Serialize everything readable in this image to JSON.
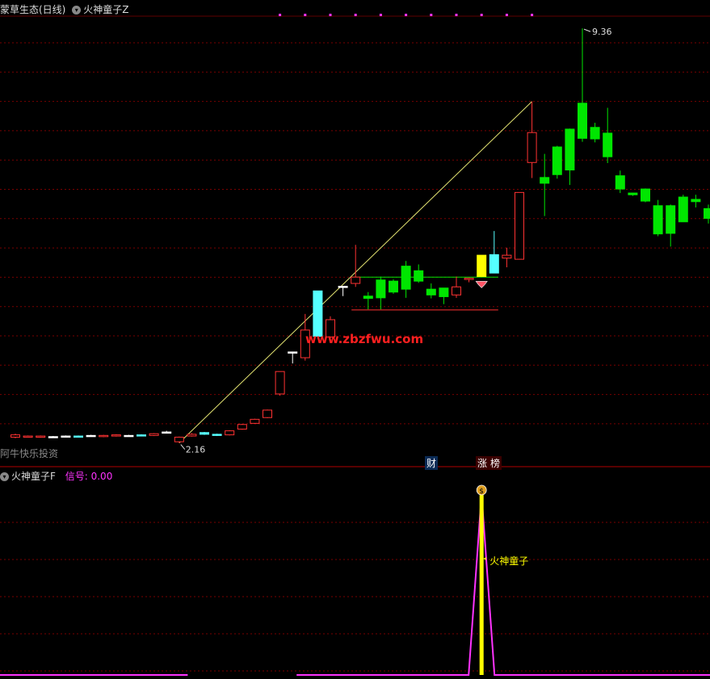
{
  "main_header": {
    "stock_name": "蒙草生态(日线)",
    "indicator_name": "火神童子Z"
  },
  "sub_header": {
    "indicator_name": "火神童子F",
    "signal_label": "信号:",
    "signal_value": "0.00"
  },
  "watermark": "www.zbzfwu.com",
  "bottom_left_label": "阿牛快乐投资",
  "markers": {
    "cai": "财",
    "zhang": "涨",
    "bang": "榜"
  },
  "colors": {
    "background": "#000000",
    "grid": "#7a0000",
    "up": "#ff3232",
    "down": "#00e600",
    "cyan": "#55ffff",
    "yellow": "#ffff00",
    "magenta": "#ff33ff",
    "trendline": "#e6e673"
  },
  "chart_data": [
    {
      "type": "candlestick",
      "title": "蒙草生态(日线)",
      "y_range": [
        2.0,
        9.6
      ],
      "low_label": "2.16",
      "high_label": "9.36",
      "candles": [
        {
          "o": 2.26,
          "c": 2.3,
          "h": 2.32,
          "l": 2.24,
          "color": "red"
        },
        {
          "o": 2.28,
          "c": 2.27,
          "h": 2.29,
          "l": 2.26,
          "color": "red"
        },
        {
          "o": 2.26,
          "c": 2.28,
          "h": 2.29,
          "l": 2.25,
          "color": "red"
        },
        {
          "o": 2.27,
          "c": 2.27,
          "h": 2.28,
          "l": 2.26,
          "color": "white"
        },
        {
          "o": 2.28,
          "c": 2.28,
          "h": 2.29,
          "l": 2.27,
          "color": "white"
        },
        {
          "o": 2.28,
          "c": 2.27,
          "h": 2.29,
          "l": 2.26,
          "color": "cyan"
        },
        {
          "o": 2.29,
          "c": 2.29,
          "h": 2.3,
          "l": 2.28,
          "color": "white"
        },
        {
          "o": 2.27,
          "c": 2.29,
          "h": 2.3,
          "l": 2.26,
          "color": "red"
        },
        {
          "o": 2.28,
          "c": 2.3,
          "h": 2.31,
          "l": 2.27,
          "color": "red"
        },
        {
          "o": 2.29,
          "c": 2.29,
          "h": 2.3,
          "l": 2.28,
          "color": "white"
        },
        {
          "o": 2.3,
          "c": 2.29,
          "h": 2.31,
          "l": 2.28,
          "color": "cyan"
        },
        {
          "o": 2.29,
          "c": 2.32,
          "h": 2.33,
          "l": 2.28,
          "color": "red"
        },
        {
          "o": 2.35,
          "c": 2.35,
          "h": 2.37,
          "l": 2.33,
          "color": "white"
        },
        {
          "o": 2.18,
          "c": 2.26,
          "h": 2.27,
          "l": 2.16,
          "color": "red"
        },
        {
          "o": 2.28,
          "c": 2.31,
          "h": 2.33,
          "l": 2.27,
          "color": "red"
        },
        {
          "o": 2.34,
          "c": 2.31,
          "h": 2.35,
          "l": 2.3,
          "color": "cyan"
        },
        {
          "o": 2.31,
          "c": 2.29,
          "h": 2.32,
          "l": 2.28,
          "color": "cyan"
        },
        {
          "o": 2.3,
          "c": 2.37,
          "h": 2.38,
          "l": 2.29,
          "color": "red"
        },
        {
          "o": 2.4,
          "c": 2.48,
          "h": 2.49,
          "l": 2.39,
          "color": "red"
        },
        {
          "o": 2.5,
          "c": 2.57,
          "h": 2.58,
          "l": 2.49,
          "color": "red"
        },
        {
          "o": 2.6,
          "c": 2.73,
          "h": 2.74,
          "l": 2.59,
          "color": "red"
        },
        {
          "o": 3.01,
          "c": 3.4,
          "h": 3.4,
          "l": 2.98,
          "color": "red"
        },
        {
          "o": 3.74,
          "c": 3.74,
          "h": 3.74,
          "l": 3.54,
          "color": "white"
        },
        {
          "o": 3.64,
          "c": 4.12,
          "h": 4.4,
          "l": 3.59,
          "color": "red"
        },
        {
          "o": 4.8,
          "c": 4.01,
          "h": 4.8,
          "l": 3.97,
          "color": "cyan"
        },
        {
          "o": 4.0,
          "c": 4.3,
          "h": 4.36,
          "l": 3.94,
          "color": "red"
        },
        {
          "o": 4.88,
          "c": 4.88,
          "h": 4.88,
          "l": 4.71,
          "color": "white"
        },
        {
          "o": 4.93,
          "c": 5.04,
          "h": 5.6,
          "l": 4.87,
          "color": "red"
        },
        {
          "o": 4.71,
          "c": 4.67,
          "h": 4.78,
          "l": 4.48,
          "color": "green"
        },
        {
          "o": 4.99,
          "c": 4.68,
          "h": 5.05,
          "l": 4.48,
          "color": "green"
        },
        {
          "o": 4.97,
          "c": 4.78,
          "h": 5.0,
          "l": 4.75,
          "color": "green"
        },
        {
          "o": 5.23,
          "c": 4.83,
          "h": 5.32,
          "l": 4.68,
          "color": "green"
        },
        {
          "o": 5.15,
          "c": 4.97,
          "h": 5.26,
          "l": 4.94,
          "color": "green"
        },
        {
          "o": 4.83,
          "c": 4.73,
          "h": 4.93,
          "l": 4.67,
          "color": "green"
        },
        {
          "o": 4.85,
          "c": 4.7,
          "h": 4.85,
          "l": 4.57,
          "color": "green"
        },
        {
          "o": 4.73,
          "c": 4.87,
          "h": 5.05,
          "l": 4.68,
          "color": "red"
        },
        {
          "o": 5.02,
          "c": 5.02,
          "h": 5.02,
          "l": 4.95,
          "color": "red"
        },
        {
          "o": 5.05,
          "c": 5.42,
          "h": 5.42,
          "l": 5.05,
          "color": "yellow"
        },
        {
          "o": 5.11,
          "c": 5.43,
          "h": 5.84,
          "l": 5.11,
          "color": "cyan"
        },
        {
          "o": 5.37,
          "c": 5.42,
          "h": 5.55,
          "l": 5.21,
          "color": "red"
        },
        {
          "o": 5.35,
          "c": 6.51,
          "h": 6.51,
          "l": 5.35,
          "color": "red"
        },
        {
          "o": 7.03,
          "c": 7.55,
          "h": 8.09,
          "l": 6.76,
          "color": "red"
        },
        {
          "o": 6.77,
          "c": 6.67,
          "h": 7.18,
          "l": 6.1,
          "color": "green"
        },
        {
          "o": 7.3,
          "c": 6.82,
          "h": 7.32,
          "l": 6.75,
          "color": "green"
        },
        {
          "o": 7.61,
          "c": 6.9,
          "h": 7.62,
          "l": 6.64,
          "color": "green"
        },
        {
          "o": 8.06,
          "c": 7.45,
          "h": 9.36,
          "l": 7.39,
          "color": "green"
        },
        {
          "o": 7.64,
          "c": 7.44,
          "h": 7.72,
          "l": 7.38,
          "color": "green"
        },
        {
          "o": 7.54,
          "c": 7.13,
          "h": 7.98,
          "l": 7.02,
          "color": "green"
        },
        {
          "o": 6.8,
          "c": 6.57,
          "h": 6.89,
          "l": 6.5,
          "color": "green"
        },
        {
          "o": 6.5,
          "c": 6.47,
          "h": 6.5,
          "l": 6.45,
          "color": "green"
        },
        {
          "o": 6.57,
          "c": 6.36,
          "h": 6.58,
          "l": 6.34,
          "color": "green"
        },
        {
          "o": 6.28,
          "c": 5.79,
          "h": 6.38,
          "l": 5.75,
          "color": "green"
        },
        {
          "o": 6.28,
          "c": 5.8,
          "h": 6.3,
          "l": 5.57,
          "color": "green"
        },
        {
          "o": 6.43,
          "c": 6.0,
          "h": 6.47,
          "l": 6.0,
          "color": "green"
        },
        {
          "o": 6.39,
          "c": 6.35,
          "h": 6.47,
          "l": 6.25,
          "color": "green"
        },
        {
          "o": 6.23,
          "c": 6.06,
          "h": 6.3,
          "l": 5.97,
          "color": "green"
        },
        {
          "o": 5.98,
          "c": 5.66,
          "h": 6.02,
          "l": 5.56,
          "color": "green"
        },
        {
          "o": 5.45,
          "c": 5.4,
          "h": 5.5,
          "l": 5.3,
          "color": "green"
        },
        {
          "o": 5.49,
          "c": 5.35,
          "h": 5.55,
          "l": 5.3,
          "color": "green"
        }
      ],
      "trendline": {
        "from": [
          13,
          2.16
        ],
        "to": [
          41,
          8.09
        ]
      },
      "range_box": {
        "start": 27,
        "end": 38,
        "top": 5.04,
        "bottom": 4.47
      },
      "diamond_marker_index": 37
    },
    {
      "type": "line",
      "title": "火神童子F",
      "series": [
        {
          "name": "信号",
          "values": [
            0,
            0,
            0,
            0,
            0,
            0,
            0,
            0,
            0,
            0,
            0,
            0,
            0,
            0,
            0,
            0,
            0,
            0,
            0,
            0,
            0,
            0,
            0,
            0,
            0,
            0,
            0,
            0,
            0,
            0,
            0,
            0,
            0,
            0,
            0,
            0,
            0,
            1,
            0,
            0,
            0,
            0,
            0,
            0,
            0,
            0,
            0,
            0,
            0,
            0,
            0,
            0,
            0,
            0,
            0,
            0,
            0,
            0,
            0
          ]
        }
      ],
      "signal_index": 37,
      "signal_label": "火神童子"
    }
  ]
}
